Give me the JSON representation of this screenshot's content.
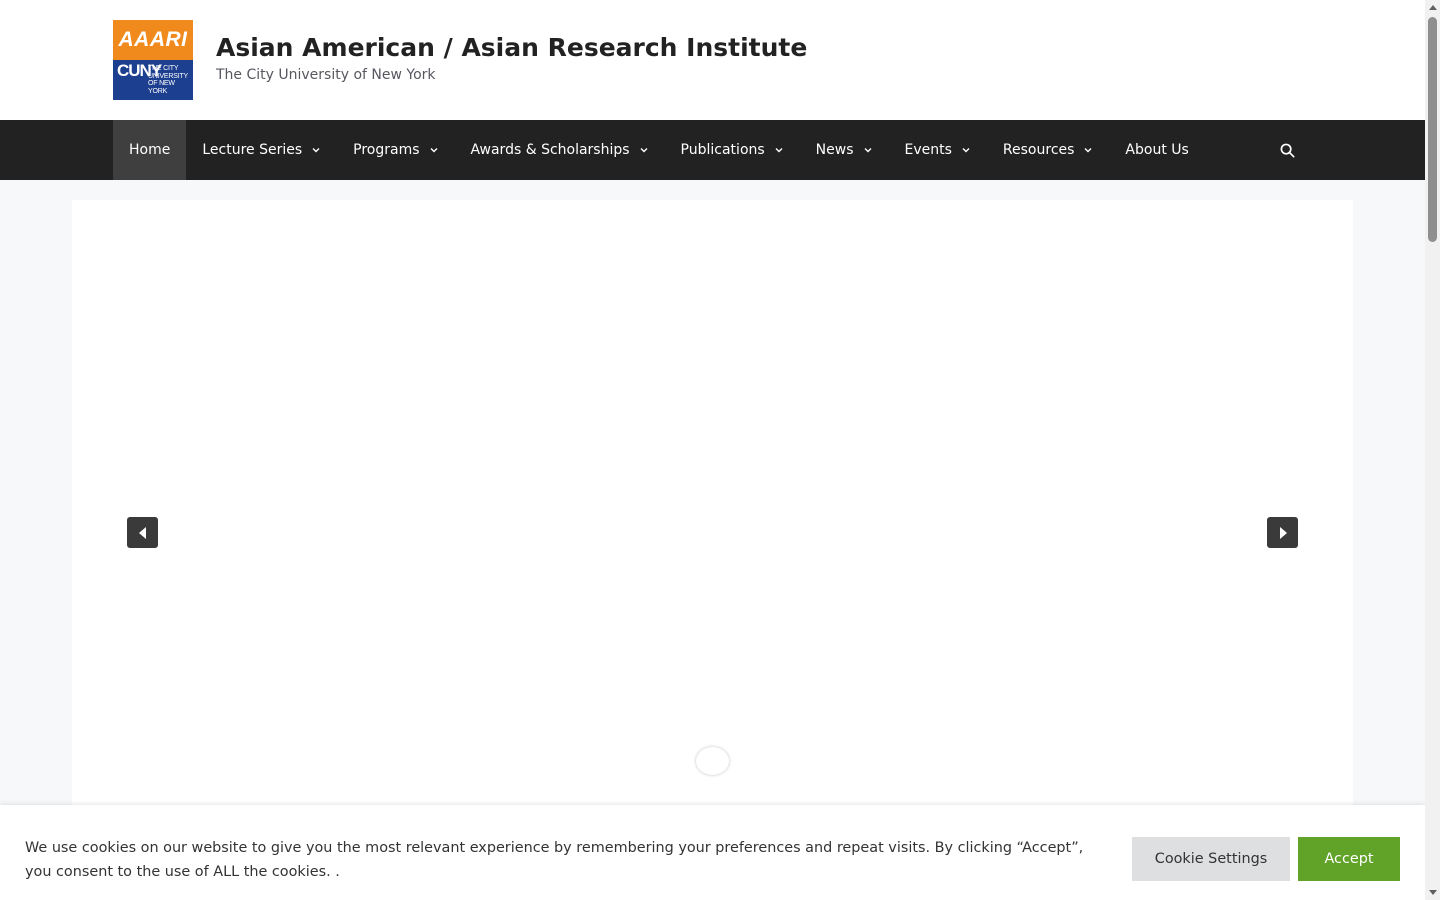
{
  "header": {
    "logo": {
      "top_text": "AAARI",
      "cuny_text": "CUNY",
      "small_text": "THE CITY UNIVERSITY OF NEW YORK",
      "colors": {
        "orange": "#f08a1c",
        "blue": "#1d3f8f"
      }
    },
    "title": "Asian American / Asian Research Institute",
    "tagline": "The City University of New York"
  },
  "nav": {
    "items": [
      {
        "label": "Home",
        "active": true,
        "has_dropdown": false
      },
      {
        "label": "Lecture Series",
        "has_dropdown": true
      },
      {
        "label": "Programs",
        "has_dropdown": true
      },
      {
        "label": "Awards & Scholarships",
        "has_dropdown": true
      },
      {
        "label": "Publications",
        "has_dropdown": true
      },
      {
        "label": "News",
        "has_dropdown": true
      },
      {
        "label": "Events",
        "has_dropdown": true
      },
      {
        "label": "Resources",
        "has_dropdown": true
      },
      {
        "label": "About Us",
        "has_dropdown": false
      }
    ],
    "search_icon": "search-icon"
  },
  "slider": {
    "prev_icon": "arrow-left-icon",
    "next_icon": "arrow-right-icon",
    "dots": 1
  },
  "cookie": {
    "text": "We use cookies on our website to give you the most relevant experience by remembering your preferences and repeat visits. By clicking “Accept”, you consent to the use of ALL the cookies. .",
    "settings_label": "Cookie Settings",
    "accept_label": "Accept",
    "accent_color": "#61a229"
  },
  "colors": {
    "nav_bg": "#222222",
    "nav_active_bg": "#3f3f3f",
    "page_bg": "#f7f8f9"
  }
}
